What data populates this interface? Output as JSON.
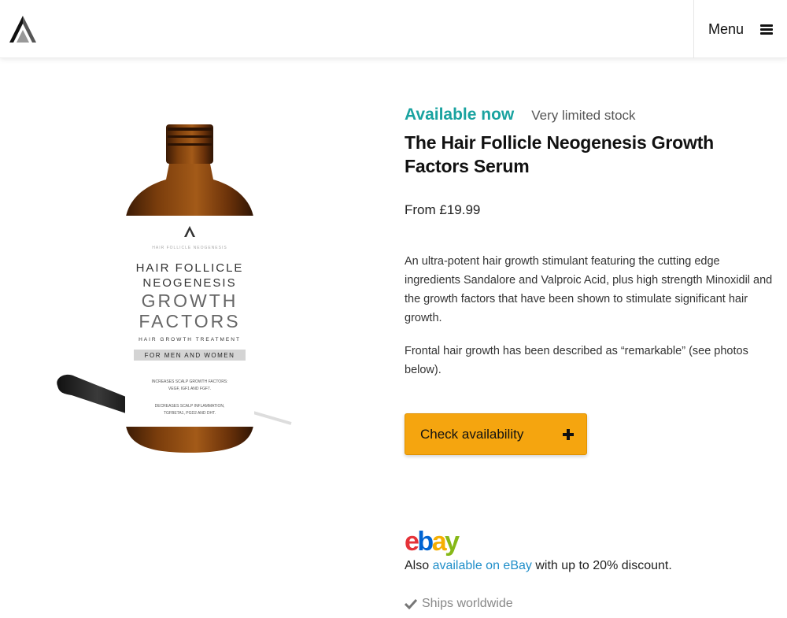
{
  "header": {
    "logo_icon": "brand-a-logo-icon",
    "menu_label": "Menu",
    "menu_icon": "hamburger-icon"
  },
  "product": {
    "image_alt": "Hair Follicle Neogenesis Growth Factors serum bottle",
    "label": {
      "brand_line": "HAIR FOLLICLE NEOGENESIS",
      "title_line1": "HAIR FOLLICLE",
      "title_line2": "NEOGENESIS",
      "title_line3": "GROWTH",
      "title_line4": "FACTORS",
      "subtitle": "HAIR GROWTH TREATMENT",
      "band": "FOR MEN AND WOMEN",
      "note1_line1": "INCREASES SCALP GROWTH FACTORS:",
      "note1_line2": "VEGF, IGF1 AND FGF7.",
      "note2_line1": "DECREASES SCALP INFLAMMATION,",
      "note2_line2": "TGFBETA1, PGD2 AND DHT."
    },
    "availability": "Available now",
    "stock_note": "Very limited stock",
    "title": "The Hair Follicle Neogenesis Growth Factors Serum",
    "price": "From £19.99",
    "description": [
      "An ultra-potent hair growth stimulant featuring the cutting edge ingredients Sandalore and Valproic Acid, plus high strength Minoxidil and the growth factors that have been shown to stimulate significant hair growth.",
      "Frontal hair growth has been described as “remarkable” (see photos below)."
    ],
    "cta_label": "Check availability",
    "cta_icon": "plus-icon"
  },
  "ebay": {
    "logo_e": "e",
    "logo_b": "b",
    "logo_a": "a",
    "logo_y": "y",
    "text_prefix": "Also ",
    "link_text": "available on eBay",
    "text_suffix": " with up to 20% discount."
  },
  "shipping": {
    "icon": "checkmark-icon",
    "text": "Ships worldwide"
  },
  "colors": {
    "accent_teal": "#1aa3a0",
    "cta_orange": "#f5a50f",
    "link_blue": "#1f8ec9"
  }
}
